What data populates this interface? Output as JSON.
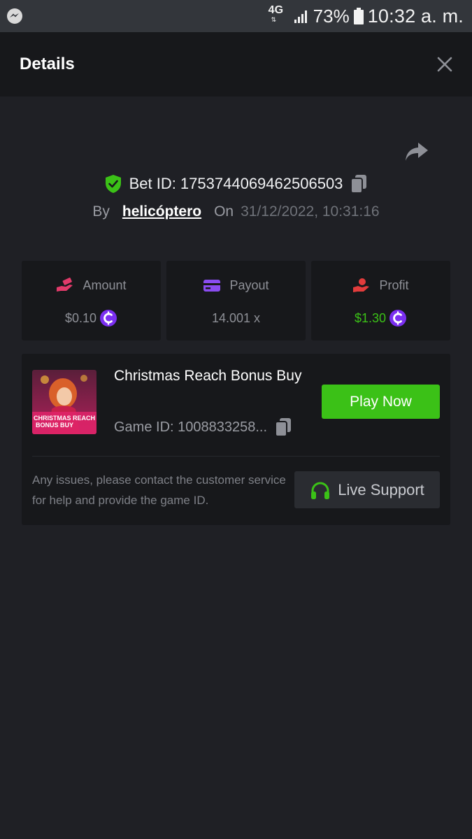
{
  "status_bar": {
    "network": "4G",
    "battery": "73%",
    "time": "10:32 a. m.",
    "icons": [
      "messenger-icon",
      "signal-icon",
      "battery-icon"
    ]
  },
  "header": {
    "title": "Details",
    "close_icon": "close-icon"
  },
  "bet": {
    "label": "Bet ID: 1753744069462506503",
    "by_label": "By",
    "username": "helicóptero",
    "on_label": "On",
    "date": "31/12/2022, 10:31:16"
  },
  "stats": [
    {
      "label": "Amount",
      "value": "$0.10",
      "icon": "hand-coins-icon",
      "color": "#e23a6a"
    },
    {
      "label": "Payout",
      "value": "14.001 x",
      "icon": "card-icon",
      "color": "#8a4cf0"
    },
    {
      "label": "Profit",
      "value": "$1.30",
      "icon": "hand-profit-icon",
      "color": "#e33c3c"
    }
  ],
  "game": {
    "name": "Christmas Reach Bonus Buy",
    "thumb_text_line1": "CHRISTMAS REACH",
    "thumb_text_line2": "BONUS BUY",
    "id": "Game ID: 1008833258...",
    "play_label": "Play Now"
  },
  "support": {
    "text": "Any issues, please contact the customer service for help and provide the game ID.",
    "button_label": "Live Support"
  },
  "colors": {
    "accent_green": "#3bc117",
    "coin_purple": "#7b2ff0",
    "background": "#1f2025",
    "card": "#17181b"
  }
}
